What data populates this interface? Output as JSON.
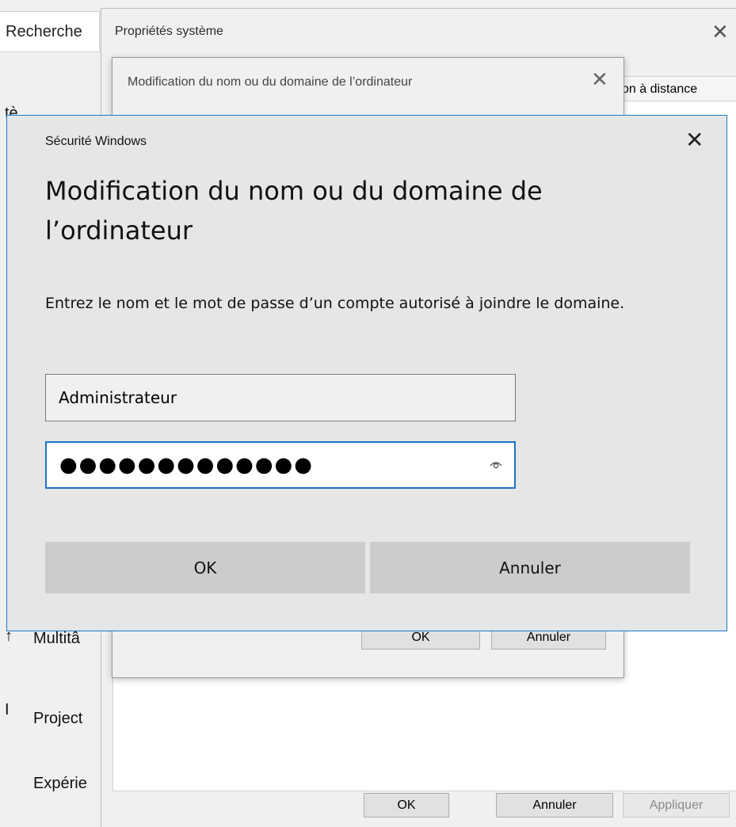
{
  "settings": {
    "search_text": "Recherche",
    "side_items": [
      {
        "glyph": "↑",
        "label": "Multitâ"
      },
      {
        "glyph": "I",
        "label": "Project"
      },
      {
        "glyph": "",
        "label": "Expérie"
      }
    ],
    "top_glyph": "tè"
  },
  "system_properties": {
    "title": "Propriétés système",
    "tab_label": "on à distance",
    "buttons": {
      "ok": "OK",
      "cancel": "Annuler",
      "apply": "Appliquer"
    }
  },
  "rename_dialog": {
    "title": "Modification du nom ou du domaine de l’ordinateur",
    "buttons": {
      "ok": "OK",
      "cancel": "Annuler"
    }
  },
  "security_dialog": {
    "title": "Sécurité Windows",
    "heading": "Modification du nom ou du domaine de l’ordinateur",
    "description": "Entrez le nom et le mot de passe d’un compte autorisé à joindre le domaine.",
    "username_value": "Administrateur",
    "password_mask": "●●●●●●●●●●●●●",
    "buttons": {
      "ok": "OK",
      "cancel": "Annuler"
    }
  },
  "colors": {
    "accent": "#1a74c7",
    "button_gray": "#cccccc"
  },
  "icons": {
    "close": "close-icon",
    "reveal_password": "eye-icon"
  }
}
